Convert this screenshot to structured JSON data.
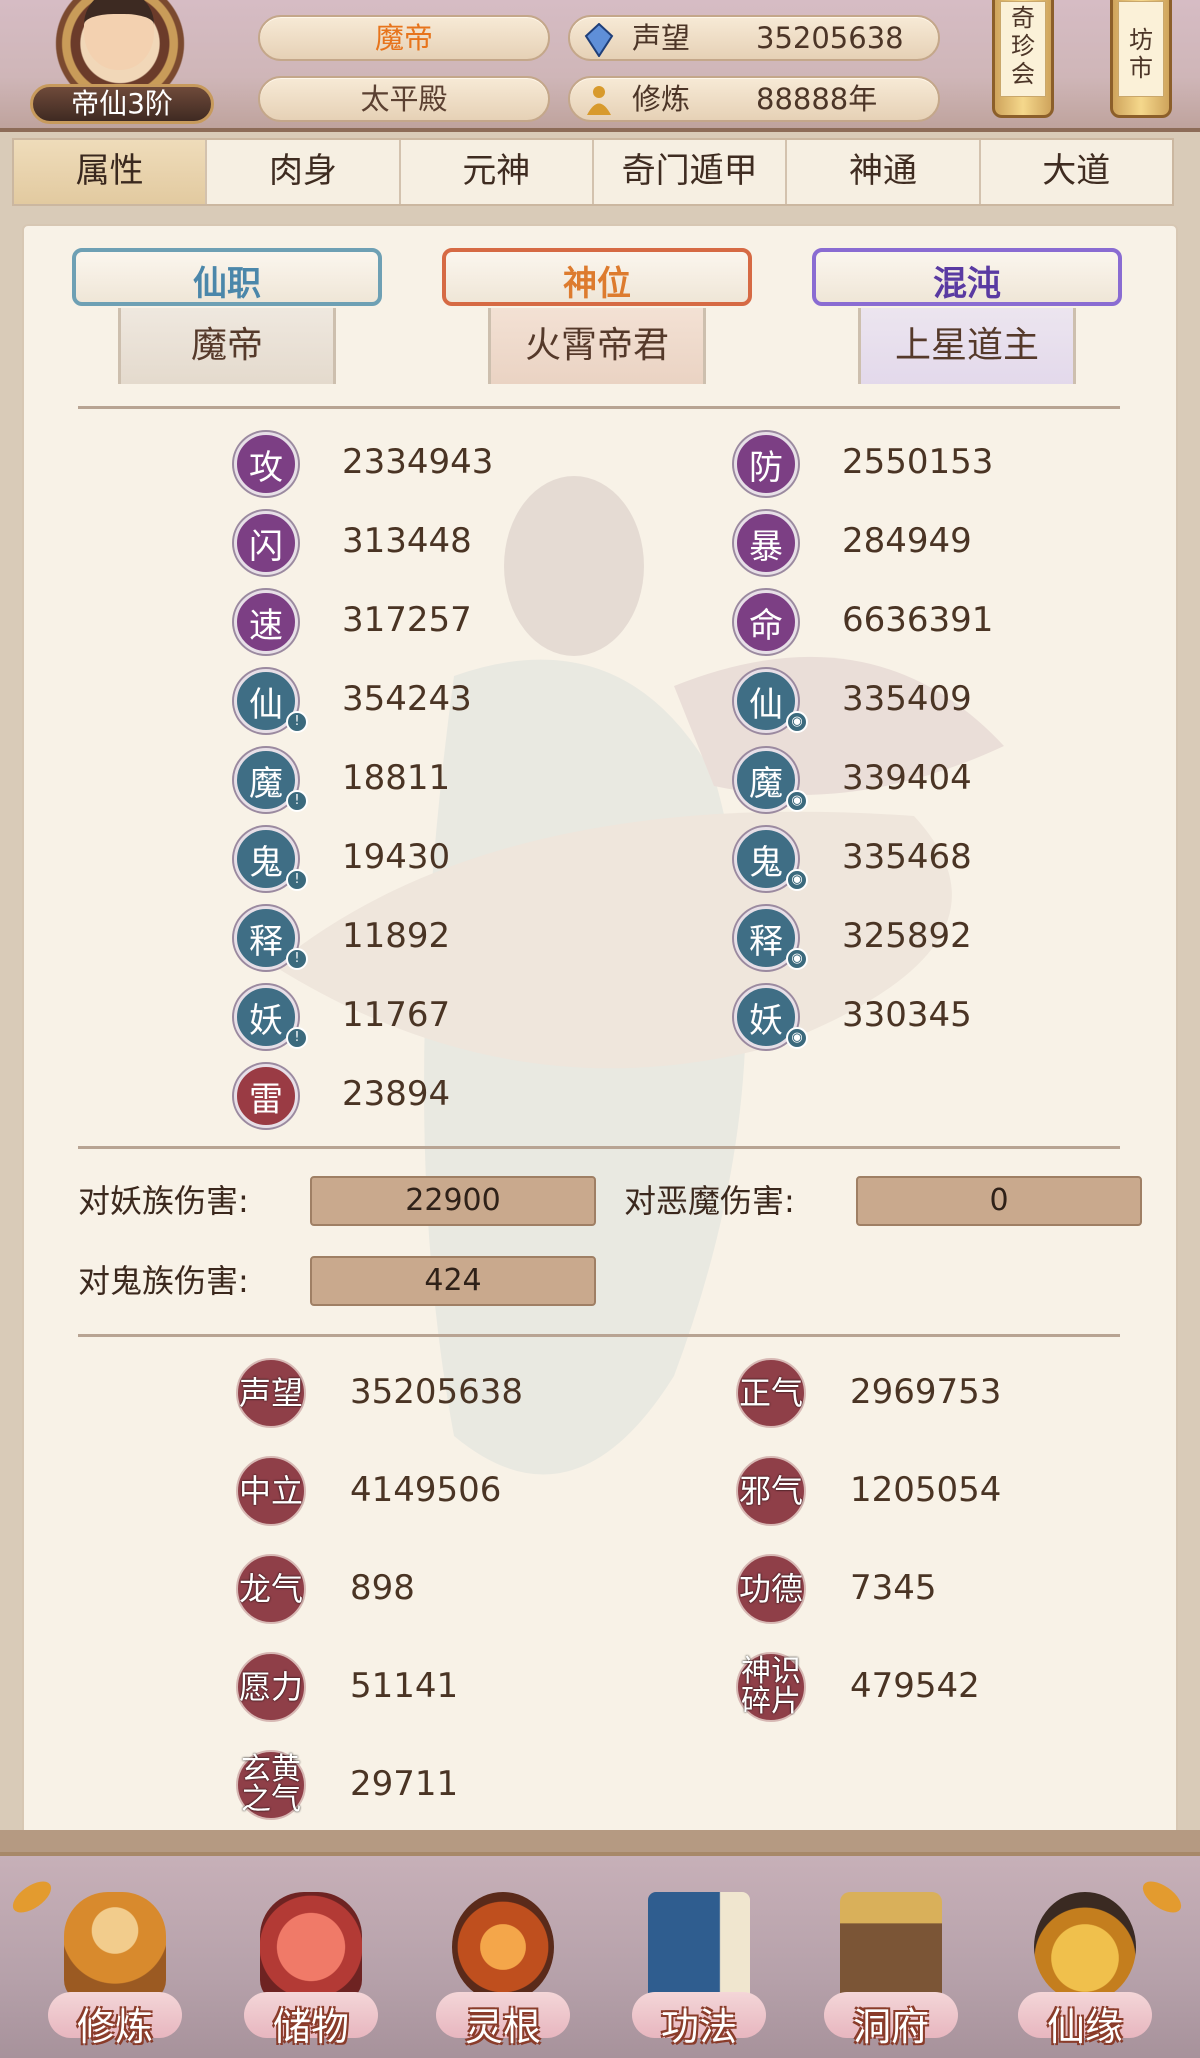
{
  "header": {
    "rank": "帝仙3阶",
    "player_name": "魔帝",
    "hall": "太平殿",
    "reputation_label": "声望",
    "reputation_value": "35205638",
    "cultivation_label": "修炼",
    "cultivation_value": "88888年",
    "shortcut_a": "奇珍会",
    "shortcut_b": "坊市"
  },
  "tabs": [
    {
      "label": "属性",
      "active": true
    },
    {
      "label": "肉身"
    },
    {
      "label": "元神"
    },
    {
      "label": "奇门遁甲"
    },
    {
      "label": "神通"
    },
    {
      "label": "大道"
    }
  ],
  "titles": [
    {
      "label": "仙职",
      "value": "魔帝"
    },
    {
      "label": "神位",
      "value": "火霄帝君"
    },
    {
      "label": "混沌",
      "value": "上星道主"
    }
  ],
  "stats_left": [
    {
      "glyph": "攻",
      "value": "2334943",
      "color": "purple"
    },
    {
      "glyph": "闪",
      "value": "313448",
      "color": "purple"
    },
    {
      "glyph": "速",
      "value": "317257",
      "color": "purple"
    },
    {
      "glyph": "仙",
      "value": "354243",
      "color": "teal",
      "mini": "!"
    },
    {
      "glyph": "魔",
      "value": "18811",
      "color": "teal",
      "mini": "!"
    },
    {
      "glyph": "鬼",
      "value": "19430",
      "color": "teal",
      "mini": "!"
    },
    {
      "glyph": "释",
      "value": "11892",
      "color": "teal",
      "mini": "!"
    },
    {
      "glyph": "妖",
      "value": "11767",
      "color": "teal",
      "mini": "!"
    },
    {
      "glyph": "雷",
      "value": "23894",
      "color": "red"
    }
  ],
  "stats_right": [
    {
      "glyph": "防",
      "value": "2550153",
      "color": "purple"
    },
    {
      "glyph": "暴",
      "value": "284949",
      "color": "purple"
    },
    {
      "glyph": "命",
      "value": "6636391",
      "color": "purple"
    },
    {
      "glyph": "仙",
      "value": "335409",
      "color": "teal",
      "mini": "◉"
    },
    {
      "glyph": "魔",
      "value": "339404",
      "color": "teal",
      "mini": "◉"
    },
    {
      "glyph": "鬼",
      "value": "335468",
      "color": "teal",
      "mini": "◉"
    },
    {
      "glyph": "释",
      "value": "325892",
      "color": "teal",
      "mini": "◉"
    },
    {
      "glyph": "妖",
      "value": "330345",
      "color": "teal",
      "mini": "◉"
    }
  ],
  "damage": {
    "yao_label": "对妖族伤害:",
    "yao_value": "22900",
    "emo_label": "对恶魔伤害:",
    "emo_value": "0",
    "gui_label": "对鬼族伤害:",
    "gui_value": "424"
  },
  "extras_left": [
    {
      "label": "声望",
      "value": "35205638"
    },
    {
      "label": "中立",
      "value": "4149506"
    },
    {
      "label": "龙气",
      "value": "898"
    },
    {
      "label": "愿力",
      "value": "51141"
    },
    {
      "label": "玄黄之气",
      "value": "29711"
    }
  ],
  "extras_right": [
    {
      "label": "正气",
      "value": "2969753"
    },
    {
      "label": "邪气",
      "value": "1205054"
    },
    {
      "label": "功德",
      "value": "7345"
    },
    {
      "label": "神识碎片",
      "value": "479542"
    }
  ],
  "nav": [
    {
      "label": "修炼",
      "icon": "monk-icon"
    },
    {
      "label": "储物",
      "icon": "bag-icon"
    },
    {
      "label": "灵根",
      "icon": "root-icon"
    },
    {
      "label": "功法",
      "icon": "book-icon"
    },
    {
      "label": "洞府",
      "icon": "house-icon"
    },
    {
      "label": "仙缘",
      "icon": "gourd-icon"
    }
  ]
}
